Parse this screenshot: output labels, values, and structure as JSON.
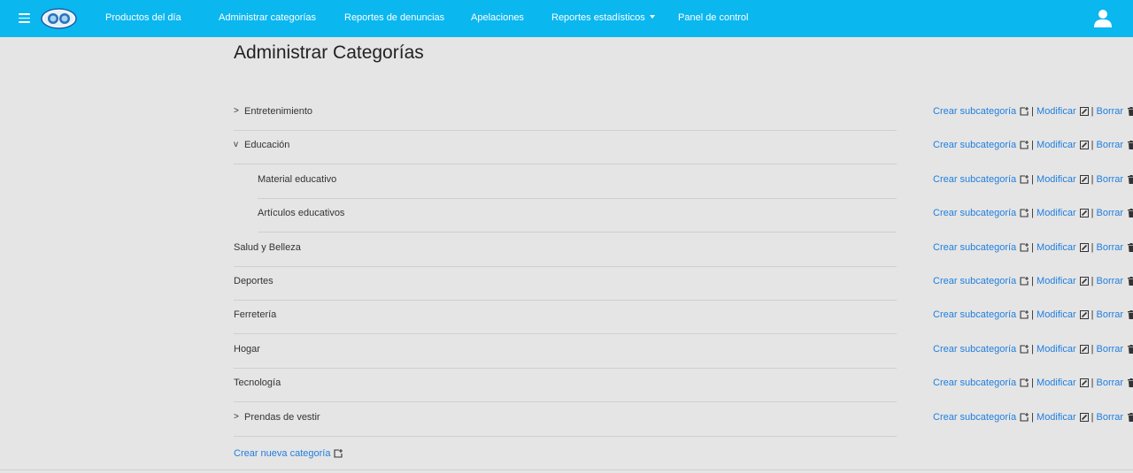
{
  "nav": {
    "items": [
      "Productos del día",
      "Administrar categorías",
      "Reportes de denuncias",
      "Apelaciones",
      "Reportes estadísticos",
      "Panel de control"
    ]
  },
  "page": {
    "title": "Administrar Categorías"
  },
  "actions": {
    "create_sub": "Crear subcategoría",
    "modify": "Modificar",
    "delete": "Borrar",
    "separator": "|"
  },
  "categories": [
    {
      "name": "Entretenimiento",
      "toggle": ">",
      "level": 0
    },
    {
      "name": "Educación",
      "toggle": "v",
      "level": 0
    },
    {
      "name": "Material educativo",
      "toggle": "",
      "level": 1
    },
    {
      "name": "Artículos educativos",
      "toggle": "",
      "level": 1
    },
    {
      "name": "Salud y Belleza",
      "toggle": "",
      "level": 0
    },
    {
      "name": "Deportes",
      "toggle": "",
      "level": 0
    },
    {
      "name": "Ferretería",
      "toggle": "",
      "level": 0
    },
    {
      "name": "Hogar",
      "toggle": "",
      "level": 0
    },
    {
      "name": "Tecnología",
      "toggle": "",
      "level": 0
    },
    {
      "name": "Prendas de vestir",
      "toggle": ">",
      "level": 0
    }
  ],
  "create_new_label": "Crear nueva categoría",
  "colors": {
    "navbar": "#0ab7ef",
    "link": "#1f7fe0",
    "background": "#e5e5e5"
  }
}
